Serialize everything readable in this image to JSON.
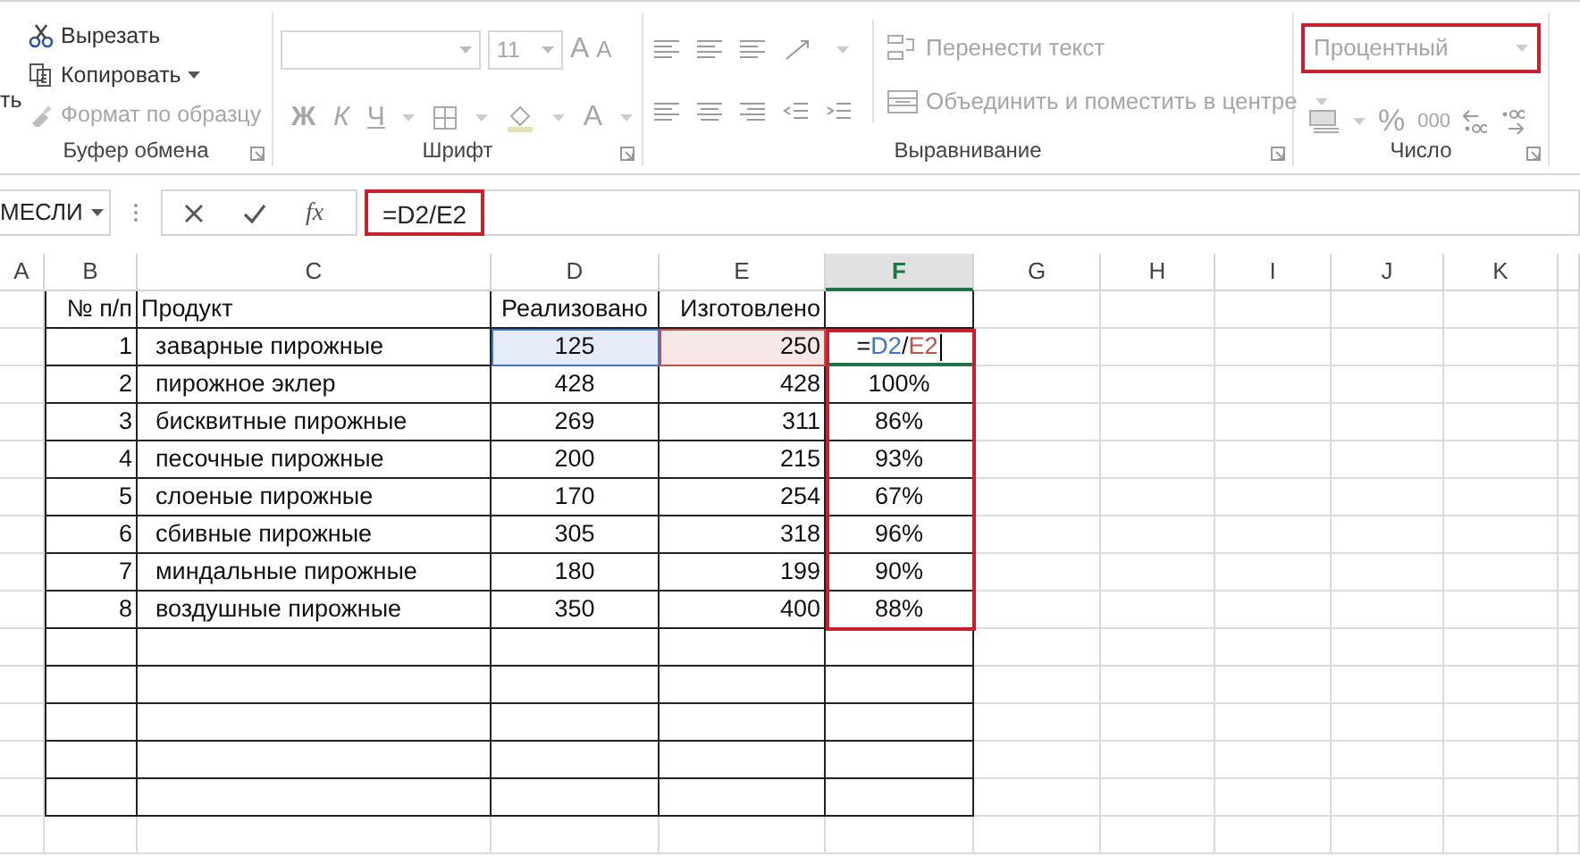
{
  "ribbon": {
    "cut_label": "ть",
    "groups": [
      {
        "kind": "clipboard",
        "label": "Буфер обмена",
        "items": [
          {
            "text": "Вырезать",
            "disabled": false
          },
          {
            "text": "Копировать",
            "disabled": false
          },
          {
            "text": "Формат по образцу",
            "disabled": true
          }
        ]
      },
      {
        "kind": "font",
        "label": "Шрифт",
        "font_size": "11",
        "size_buttons": [
          "A",
          "A"
        ],
        "style_buttons": [
          "Ж",
          "К",
          "Ч"
        ],
        "color_button": "A",
        "disabled": true
      },
      {
        "kind": "alignment",
        "label": "Выравнивание",
        "commands": [
          "Перенести текст",
          "Объединить и поместить в центре"
        ],
        "disabled": true
      },
      {
        "kind": "number",
        "label": "Число",
        "format": "Процентный",
        "format_highlighted": true,
        "symbols": [
          "%",
          "000"
        ],
        "disabled": true
      }
    ]
  },
  "formula_bar": {
    "name_box": "МЕСЛИ",
    "function_label": "fx",
    "formula": "=D2/E2",
    "formula_highlighted": true
  },
  "sheet": {
    "columns": [
      {
        "letter": "A",
        "selected": false
      },
      {
        "letter": "B",
        "selected": false
      },
      {
        "letter": "C",
        "selected": false
      },
      {
        "letter": "D",
        "selected": false
      },
      {
        "letter": "E",
        "selected": false
      },
      {
        "letter": "F",
        "selected": true
      },
      {
        "letter": "G",
        "selected": false
      },
      {
        "letter": "H",
        "selected": false
      },
      {
        "letter": "I",
        "selected": false
      },
      {
        "letter": "J",
        "selected": false
      },
      {
        "letter": "K",
        "selected": false
      }
    ],
    "header": [
      "№ п/п",
      "Продукт",
      "Реализовано",
      "Изготовлено"
    ],
    "rows": [
      {
        "n": "1",
        "product": "заварные пирожные",
        "sold": "125",
        "made": "250",
        "editing": true,
        "edit_tokens": [
          {
            "text": "=",
            "kind": "plain"
          },
          {
            "text": "D2",
            "kind": "ref",
            "color": "#4472c4"
          },
          {
            "text": "/",
            "kind": "plain"
          },
          {
            "text": "E2",
            "kind": "ref",
            "color": "#c0504d"
          }
        ]
      },
      {
        "n": "2",
        "product": "пирожное эклер",
        "sold": "428",
        "made": "428",
        "ratio": "100%"
      },
      {
        "n": "3",
        "product": "бисквитные пирожные",
        "sold": "269",
        "made": "311",
        "ratio": "86%"
      },
      {
        "n": "4",
        "product": "песочные пирожные",
        "sold": "200",
        "made": "215",
        "ratio": "93%"
      },
      {
        "n": "5",
        "product": "слоеные пирожные",
        "sold": "170",
        "made": "254",
        "ratio": "67%"
      },
      {
        "n": "6",
        "product": "сбивные пирожные",
        "sold": "305",
        "made": "318",
        "ratio": "96%"
      },
      {
        "n": "7",
        "product": "миндальные пирожные",
        "sold": "180",
        "made": "199",
        "ratio": "90%"
      },
      {
        "n": "8",
        "product": "воздушные пирожные",
        "sold": "350",
        "made": "400",
        "ratio": "88%"
      }
    ],
    "result_range_highlighted": true
  }
}
